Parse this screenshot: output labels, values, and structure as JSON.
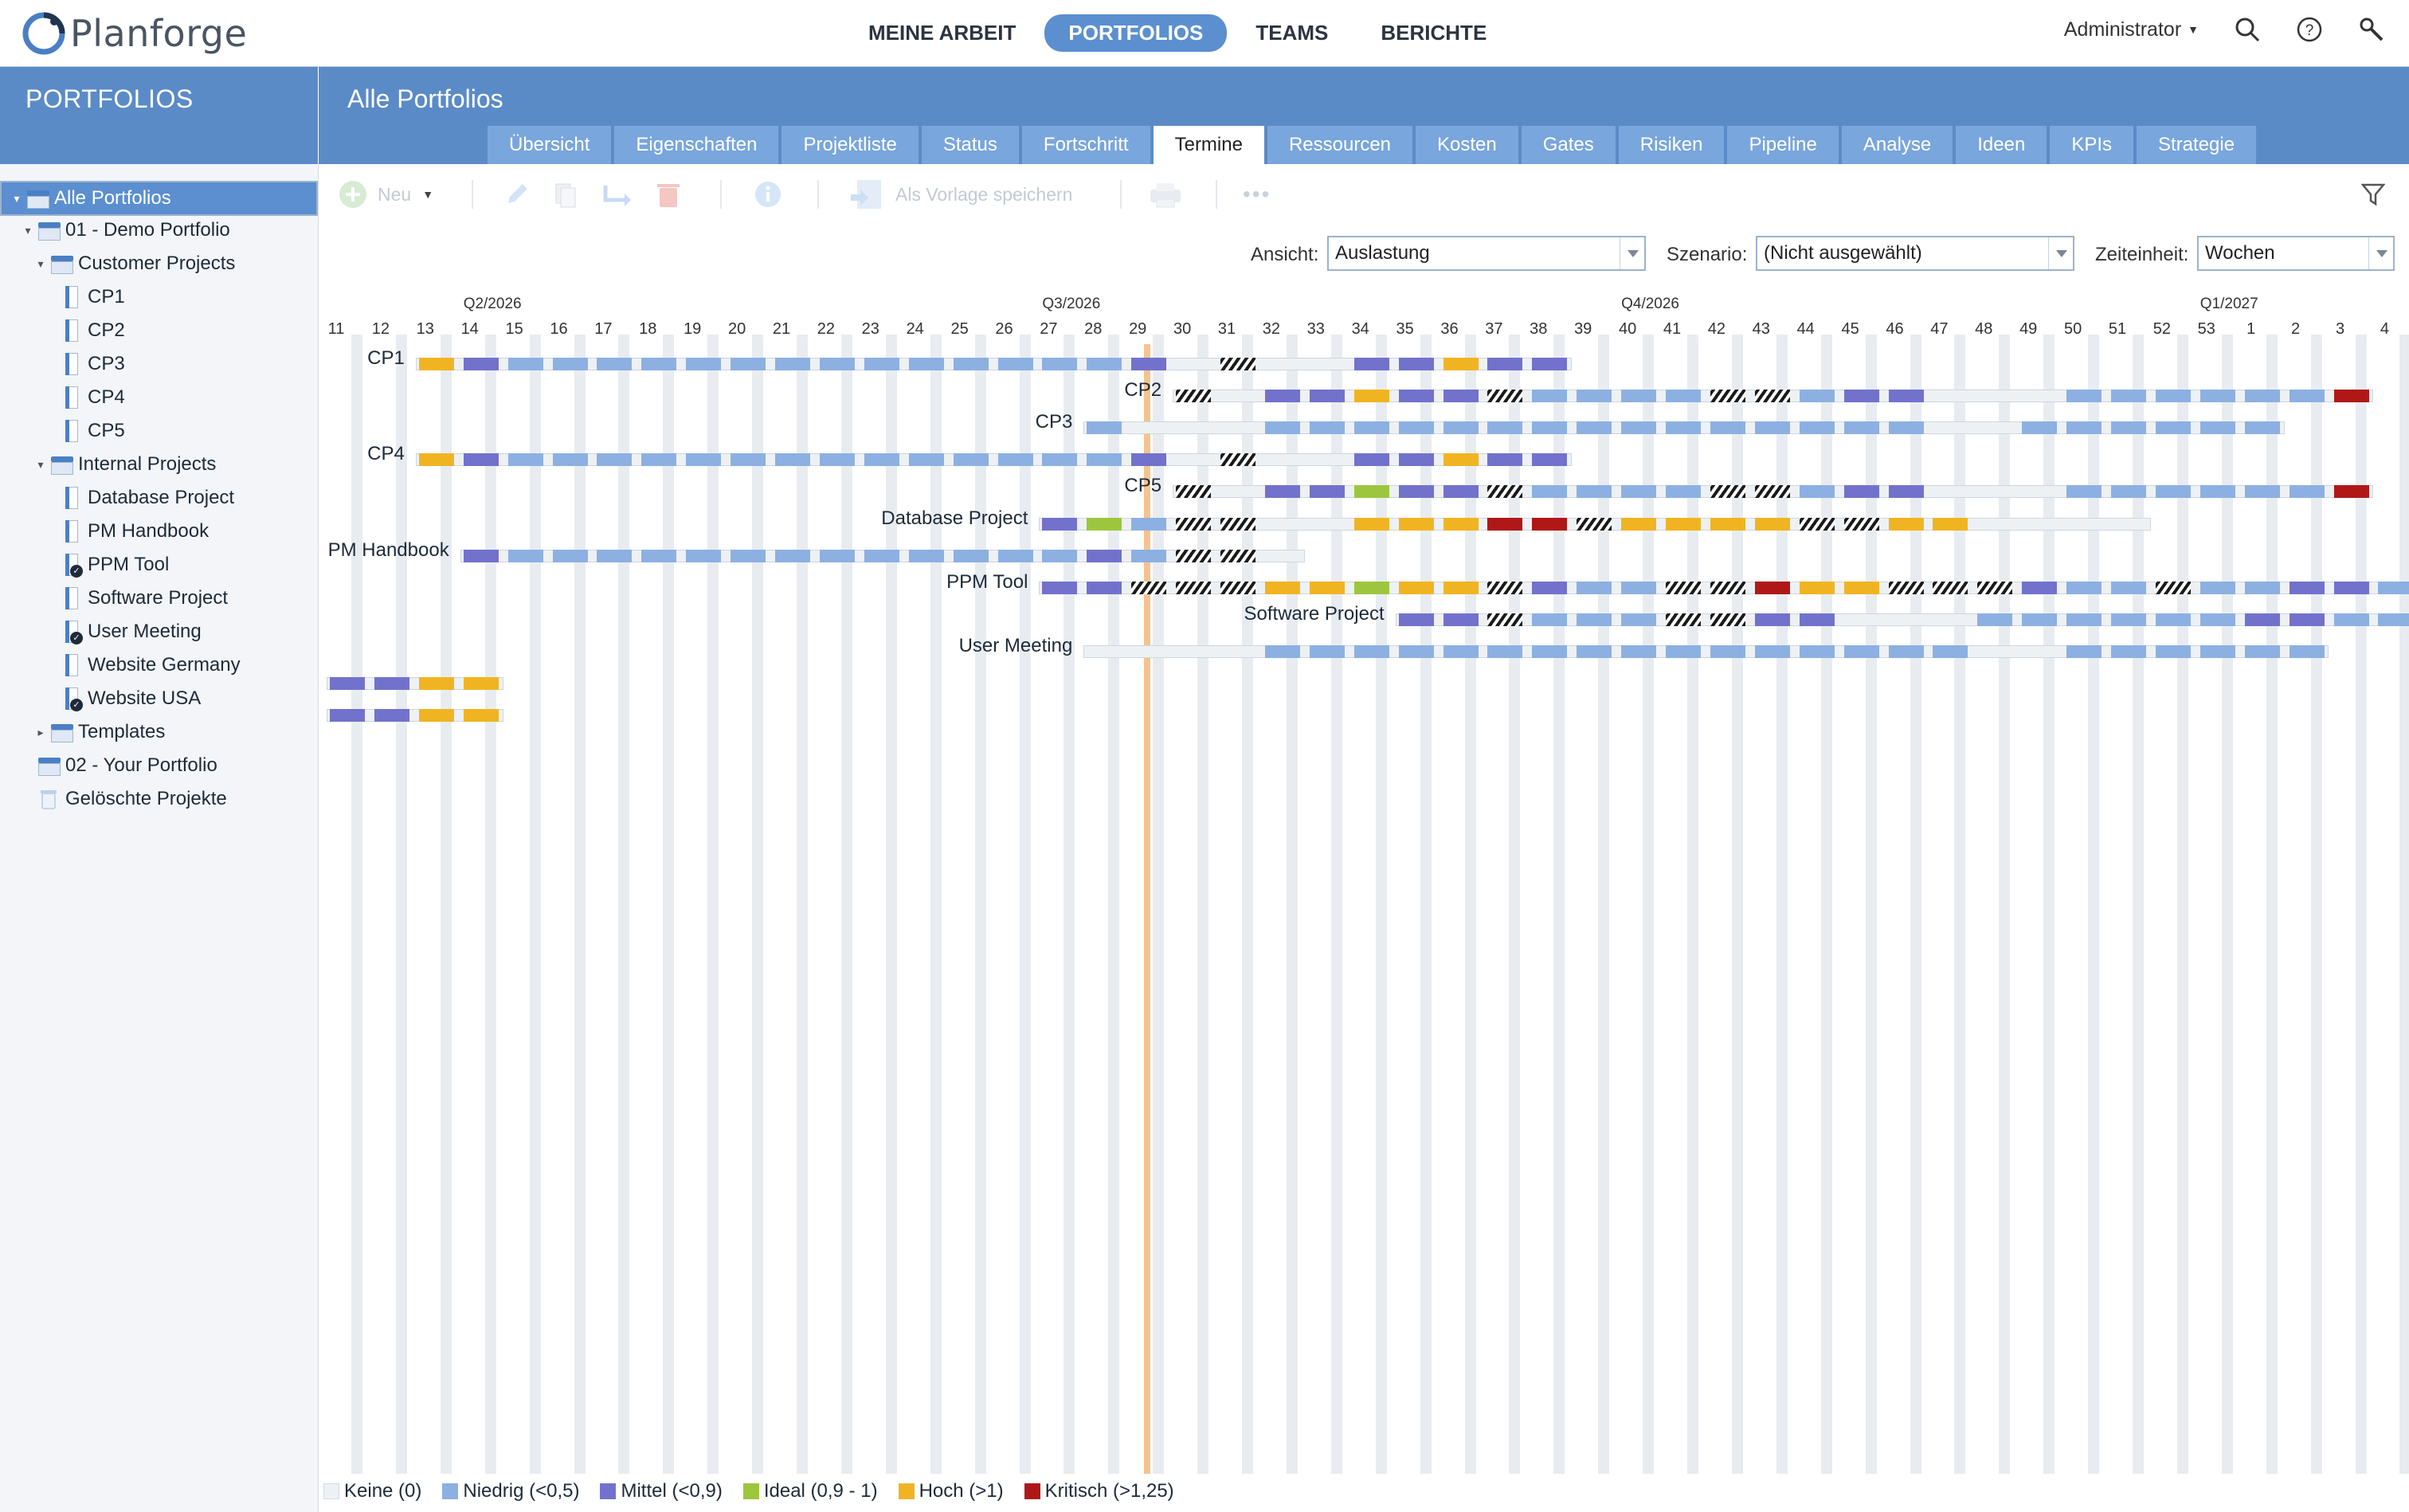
{
  "app": {
    "logo_text": "Planforge",
    "nav": [
      "MEINE ARBEIT",
      "PORTFOLIOS",
      "TEAMS",
      "BERICHTE"
    ],
    "nav_active": 1,
    "user": "Administrator"
  },
  "sidebar": {
    "title": "PORTFOLIOS",
    "tree": [
      {
        "label": "Alle Portfolios",
        "kind": "folder",
        "level": 0,
        "toggle": "▾",
        "selected": true
      },
      {
        "label": "01 - Demo Portfolio",
        "kind": "folder",
        "level": 1,
        "toggle": "▾"
      },
      {
        "label": "Customer Projects",
        "kind": "folder",
        "level": 2,
        "toggle": "▾"
      },
      {
        "label": "CP1",
        "kind": "project",
        "level": 3
      },
      {
        "label": "CP2",
        "kind": "project",
        "level": 3
      },
      {
        "label": "CP3",
        "kind": "project",
        "level": 3
      },
      {
        "label": "CP4",
        "kind": "project",
        "level": 3
      },
      {
        "label": "CP5",
        "kind": "project",
        "level": 3
      },
      {
        "label": "Internal Projects",
        "kind": "folder",
        "level": 2,
        "toggle": "▾"
      },
      {
        "label": "Database Project",
        "kind": "project",
        "level": 3
      },
      {
        "label": "PM Handbook",
        "kind": "project",
        "level": 3
      },
      {
        "label": "PPM Tool",
        "kind": "project",
        "level": 3,
        "done": true
      },
      {
        "label": "Software Project",
        "kind": "project",
        "level": 3
      },
      {
        "label": "User Meeting",
        "kind": "project",
        "level": 3,
        "done": true
      },
      {
        "label": "Website Germany",
        "kind": "project",
        "level": 3
      },
      {
        "label": "Website USA",
        "kind": "project",
        "level": 3,
        "done": true
      },
      {
        "label": "Templates",
        "kind": "folder",
        "level": 2,
        "toggle": "▸"
      },
      {
        "label": "02 - Your Portfolio",
        "kind": "folder",
        "level": 1
      },
      {
        "label": "Gelöschte Projekte",
        "kind": "trash",
        "level": 1
      }
    ]
  },
  "main": {
    "title": "Alle Portfolios",
    "tabs": [
      "Übersicht",
      "Eigenschaften",
      "Projektliste",
      "Status",
      "Fortschritt",
      "Termine",
      "Ressourcen",
      "Kosten",
      "Gates",
      "Risiken",
      "Pipeline",
      "Analyse",
      "Ideen",
      "KPIs",
      "Strategie"
    ],
    "active_tab": 5
  },
  "toolbar": {
    "new_label": "Neu",
    "save_template_label": "Als Vorlage speichern"
  },
  "filters": {
    "ansicht_label": "Ansicht:",
    "ansicht_value": "Auslastung",
    "szenario_label": "Szenario:",
    "szenario_value": "(Nicht ausgewählt)",
    "zeiteinheit_label": "Zeiteinheit:",
    "zeiteinheit_value": "Wochen"
  },
  "chart_data": {
    "type": "gantt-heatmap",
    "quarters": [
      "Q2/2026",
      "Q3/2026",
      "Q4/2026",
      "Q1/2027"
    ],
    "weeks": [
      "11",
      "12",
      "13",
      "14",
      "15",
      "16",
      "17",
      "18",
      "19",
      "20",
      "21",
      "22",
      "23",
      "24",
      "25",
      "26",
      "27",
      "28",
      "29",
      "30",
      "31",
      "32",
      "33",
      "34",
      "35",
      "36",
      "37",
      "38",
      "39",
      "40",
      "41",
      "42",
      "43",
      "44",
      "45",
      "46",
      "47",
      "48",
      "49",
      "50",
      "51",
      "52",
      "53",
      "1",
      "2",
      "3",
      "4"
    ],
    "today_week": "29",
    "colors": {
      "K": "#eef1f4",
      "N": "#8db0e2",
      "M": "#7272cc",
      "I": "#9dc63e",
      "H": "#f0b423",
      "C": "#b01818",
      "X": "hatched"
    },
    "legend": [
      {
        "key": "K",
        "label": "Keine (0)",
        "color": "#eef1f4"
      },
      {
        "key": "N",
        "label": "Niedrig (<0,5)",
        "color": "#8db0e2"
      },
      {
        "key": "M",
        "label": "Mittel (<0,9)",
        "color": "#7272cc"
      },
      {
        "key": "I",
        "label": "Ideal (0,9 - 1)",
        "color": "#9dc63e"
      },
      {
        "key": "H",
        "label": "Hoch (>1)",
        "color": "#f0b423"
      },
      {
        "key": "C",
        "label": "Kritisch (>1,25)",
        "color": "#b01818"
      }
    ],
    "rows": [
      {
        "name": "CP1",
        "start": "13",
        "cells": "HMNNNNNNNNNNNNNNMKXKKMMHMM"
      },
      {
        "name": "CP2",
        "start": "30",
        "cells": "XKMMHMMXNNNNXXNMMKKKNNNNNNC"
      },
      {
        "name": "CP3",
        "start": "28",
        "cells": "NKKKNNNNNNNNNNNNNNNKKNNNNNN"
      },
      {
        "name": "CP4",
        "start": "13",
        "cells": "HMNNNNNNNNNNNNNNMKXKKMMHMM"
      },
      {
        "name": "CP5",
        "start": "30",
        "cells": "XKMMIMMXNNNNXXNMMKKKNNNNNNC"
      },
      {
        "name": "Database Project",
        "start": "27",
        "cells": "MINXXKKHHHCCXHHHHXXHHKKKK"
      },
      {
        "name": "PM Handbook",
        "start": "14",
        "cells": "MNNNNNNNNNNNNNMNXXK"
      },
      {
        "name": "PPM Tool",
        "start": "27",
        "cells": "MMXXXHHIHHXMNNXXCHHXXXMNNXNNMMNNN"
      },
      {
        "name": "Software Project",
        "start": "35",
        "cells": "MMXNNNXXMMKKKNNNNNNMMNN"
      },
      {
        "name": "User Meeting",
        "start": "28",
        "cells": "KKKKNNNNNNNNNNNNNNNNKKNNNNNN"
      },
      {
        "name": "",
        "start": "11",
        "cells": "MMHH"
      },
      {
        "name": "",
        "start": "11",
        "cells": "MMHH"
      }
    ]
  }
}
